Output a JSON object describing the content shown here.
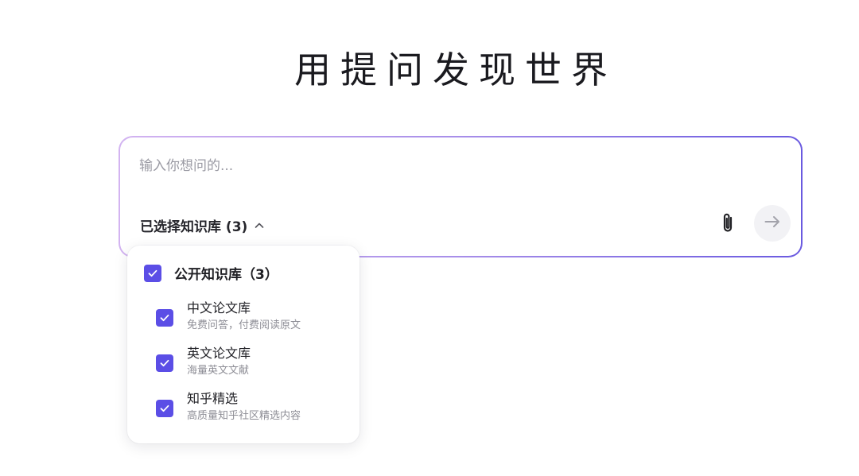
{
  "hero": {
    "title": "用提问发现世界"
  },
  "query": {
    "placeholder": "输入你想问的...",
    "value": "",
    "kb_selector_label": "已选择知识库 (3)",
    "attach_icon": "paperclip-icon",
    "send_icon": "arrow-right-icon"
  },
  "dropdown": {
    "group": {
      "label": "公开知识库（3）",
      "checked": true
    },
    "items": [
      {
        "title": "中文论文库",
        "desc": "免费问答，付费阅读原文",
        "checked": true
      },
      {
        "title": "英文论文库",
        "desc": "海量英文文献",
        "checked": true
      },
      {
        "title": "知乎精选",
        "desc": "高质量知乎社区精选内容",
        "checked": true
      }
    ]
  },
  "colors": {
    "accent": "#5b4ee6",
    "border_gradient_start": "#d3b4f1",
    "border_gradient_end": "#6a5ae0"
  }
}
